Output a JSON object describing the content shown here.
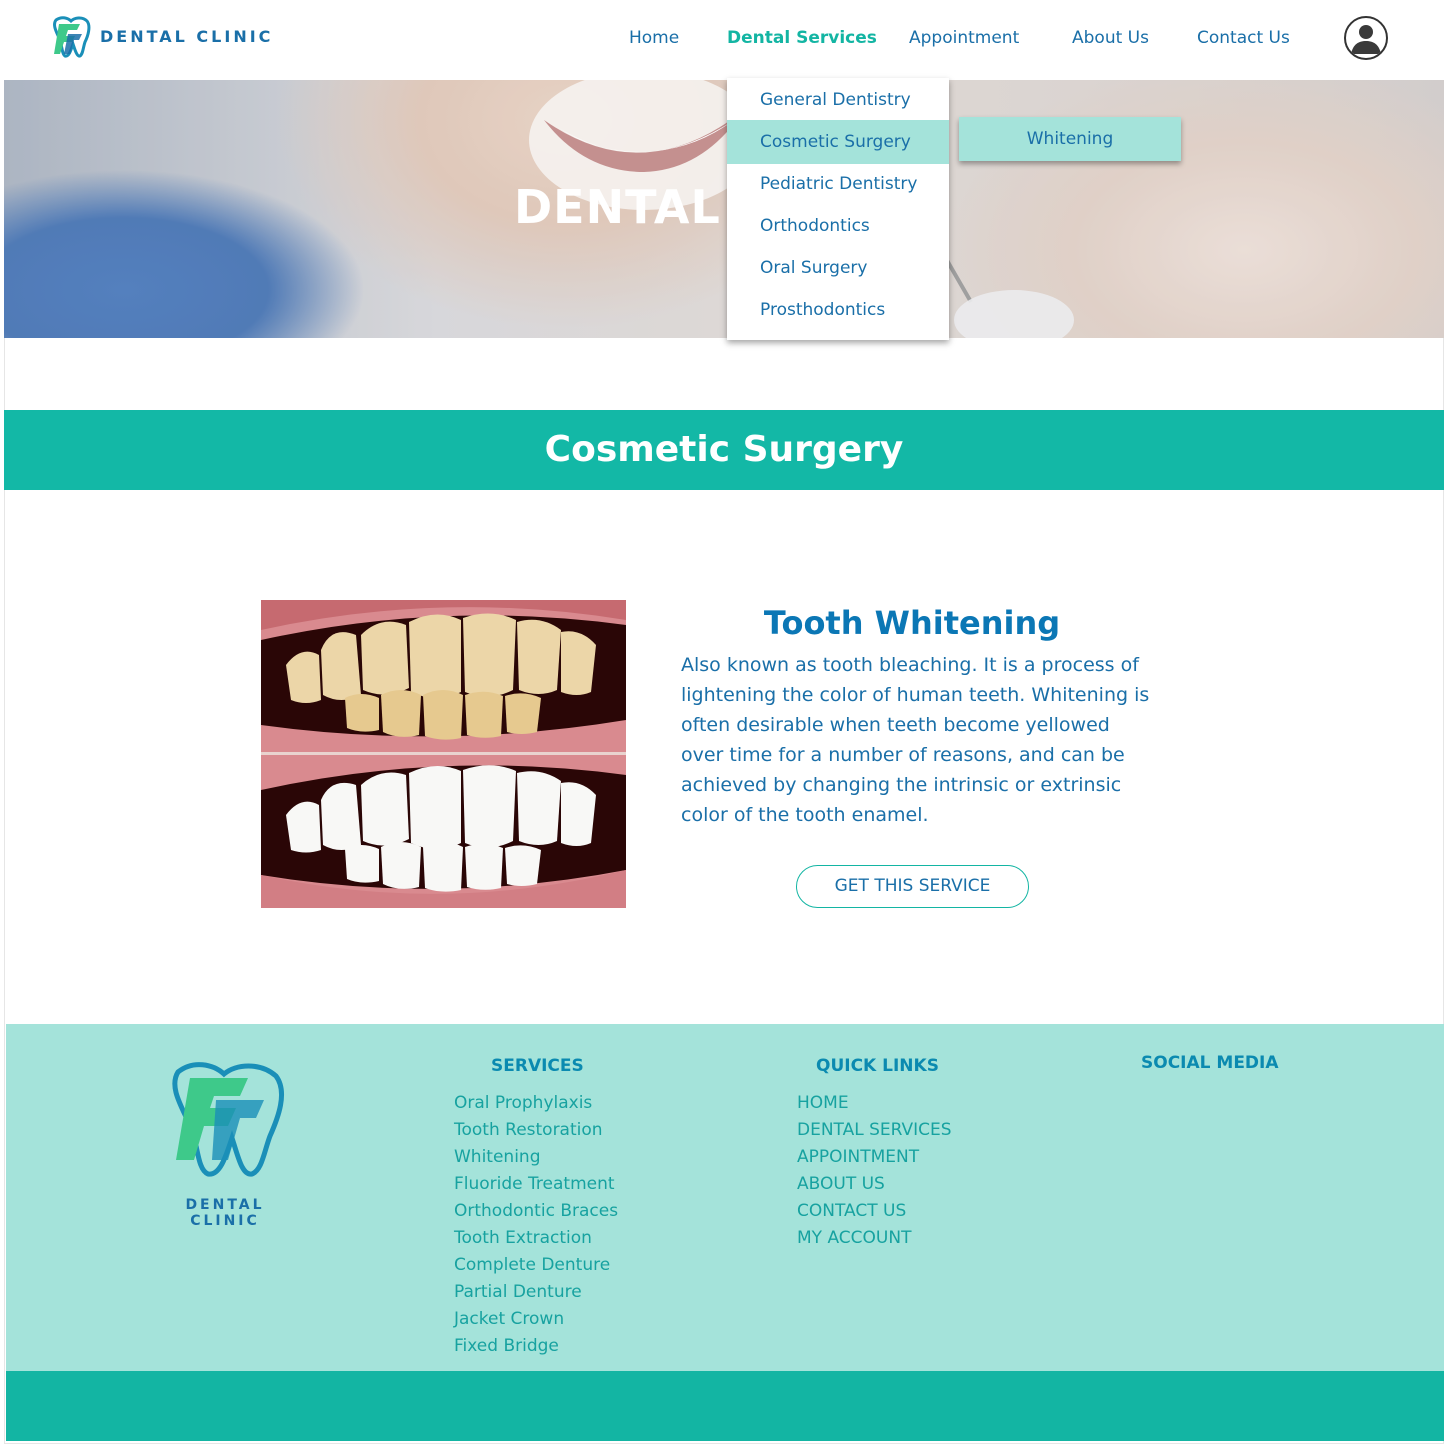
{
  "header": {
    "brand": "DENTAL CLINIC",
    "nav": [
      "Home",
      "Dental Services",
      "Appointment",
      "About Us",
      "Contact Us"
    ],
    "active_nav": "Dental Services"
  },
  "hero": {
    "title": "DENTAL S"
  },
  "dropdown": {
    "items": [
      "General Dentistry",
      "Cosmetic Surgery",
      "Pediatric Dentistry",
      "Orthodontics",
      "Oral Surgery",
      "Prosthodontics"
    ],
    "highlighted": "Cosmetic Surgery",
    "submenu": [
      "Whitening"
    ]
  },
  "section": {
    "title": "Cosmetic Surgery"
  },
  "service": {
    "title": "Tooth Whitening",
    "description": "Also known as tooth bleaching. It is a process of lightening the color of human teeth. Whitening is often desirable when teeth become yellowed over time for a number of reasons, and can be achieved by changing the intrinsic or extrinsic color of the tooth enamel.",
    "button": "GET THIS SERVICE"
  },
  "footer": {
    "brand": "DENTAL CLINIC",
    "services_heading": "SERVICES",
    "services": [
      "Oral Prophylaxis",
      "Tooth Restoration",
      "Whitening",
      "Fluoride Treatment",
      "Orthodontic Braces",
      "Tooth Extraction",
      "Complete Denture",
      "Partial Denture",
      "Jacket Crown",
      "Fixed Bridge"
    ],
    "quick_links_heading": "QUICK LINKS",
    "quick_links": [
      "HOME",
      "DENTAL SERVICES",
      "APPOINTMENT",
      "ABOUT US",
      "CONTACT US",
      "MY ACCOUNT"
    ],
    "social_heading": "SOCIAL MEDIA"
  },
  "colors": {
    "teal": "#13b8a6",
    "light_teal": "#a4e3da",
    "blue": "#0b77b5"
  },
  "icons": {
    "logo": "tooth-logo-icon",
    "account": "user-avatar-icon"
  }
}
